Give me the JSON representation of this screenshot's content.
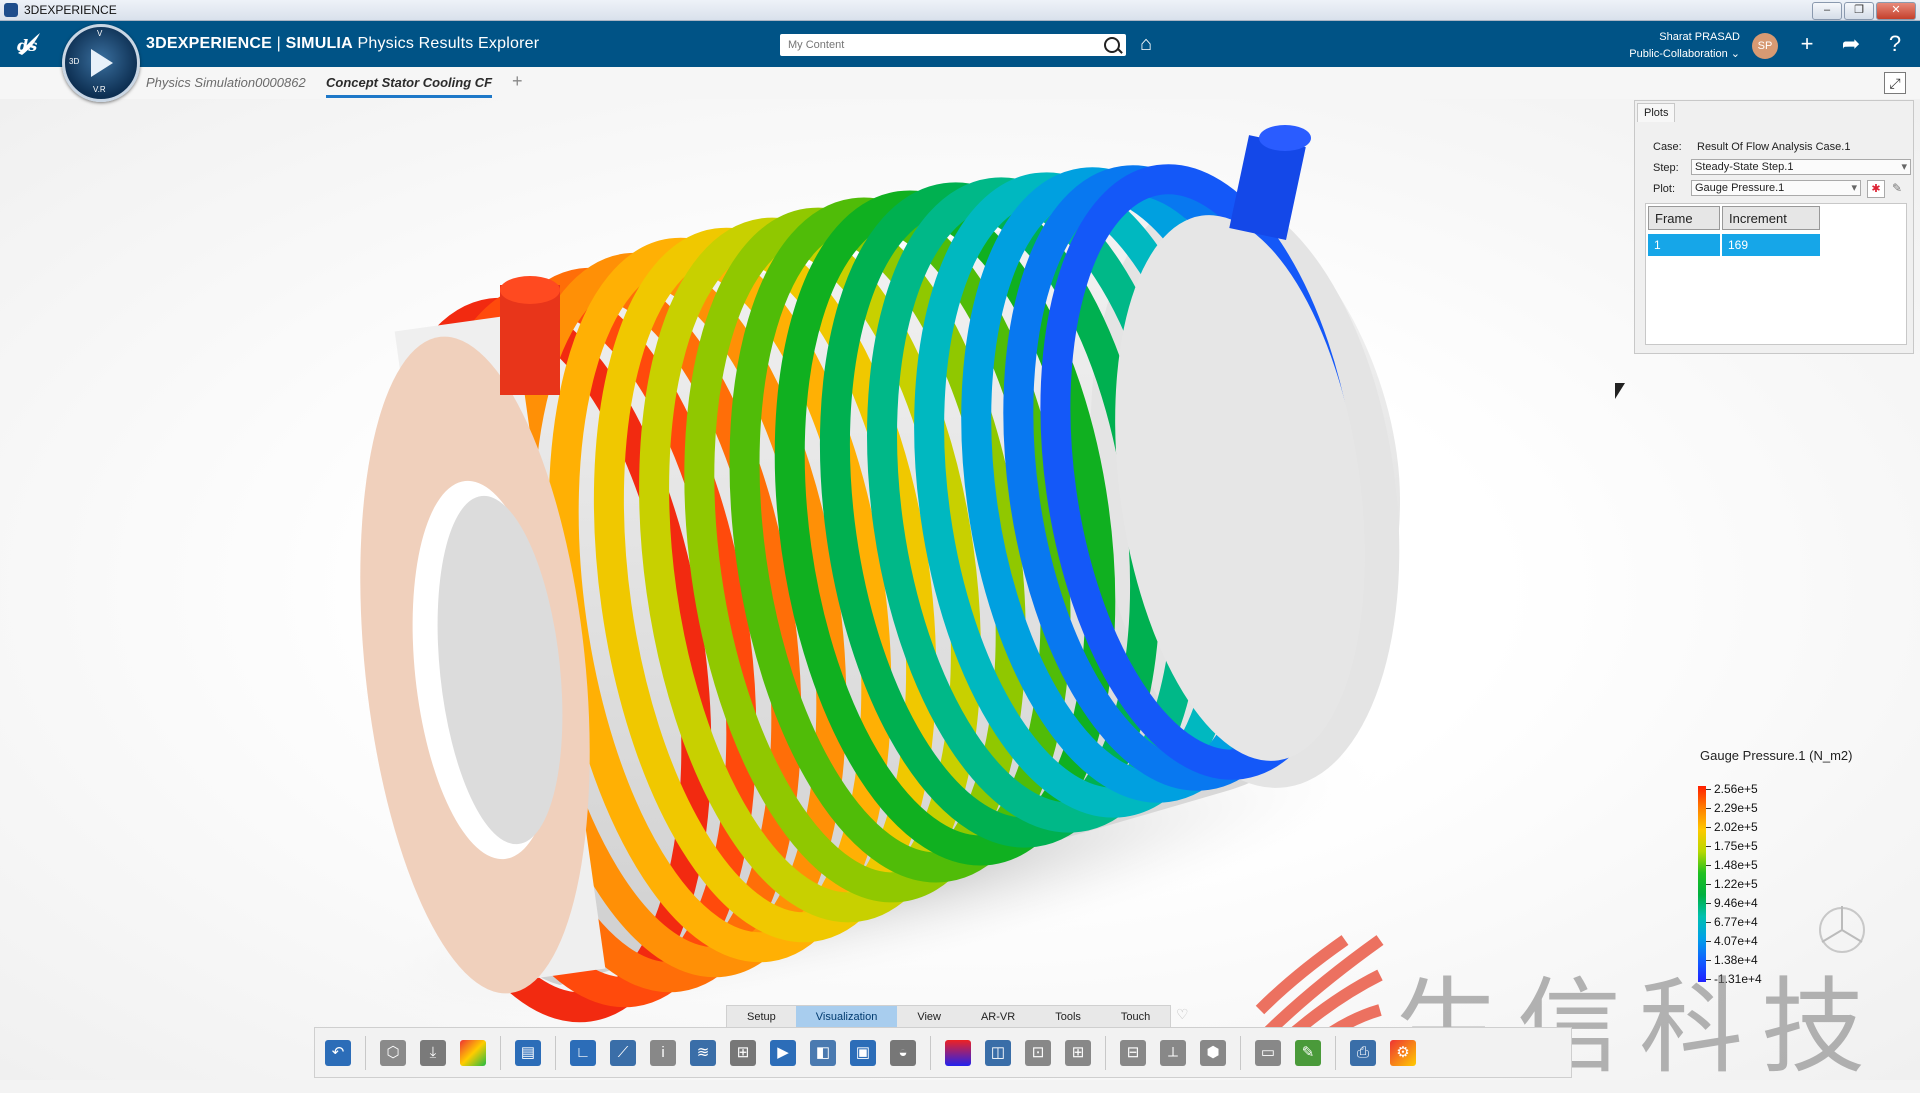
{
  "window": {
    "title": "3DEXPERIENCE",
    "controls": [
      "–",
      "❐",
      "✕"
    ]
  },
  "app": {
    "brand_bold": "3DEXPERIENCE",
    "brand_sep": " | ",
    "brand_sub": "SIMULIA",
    "app_name": " Physics Results Explorer"
  },
  "compass": {
    "top": "V",
    "left": "3D",
    "bottom": "V.R"
  },
  "search": {
    "placeholder": "My Content"
  },
  "user": {
    "name": "Sharat PRASAD",
    "space": "Public-Collaboration",
    "initials": "SP"
  },
  "tabs": [
    {
      "label": "Physics Simulation0000862",
      "active": false
    },
    {
      "label": "Concept Stator Cooling CF",
      "active": true
    }
  ],
  "plots_panel": {
    "tab_label": "Plots",
    "case_label": "Case:",
    "case_value": "Result Of Flow Analysis Case.1",
    "step_label": "Step:",
    "step_value": "Steady-State Step.1",
    "plot_label": "Plot:",
    "plot_value": "Gauge Pressure.1",
    "table": {
      "headers": [
        "Frame",
        "Increment"
      ],
      "rows": [
        [
          "1",
          "169"
        ]
      ]
    }
  },
  "legend": {
    "title": "Gauge Pressure.1 (N_m2)",
    "values": [
      "2.56e+5",
      "2.29e+5",
      "2.02e+5",
      "1.75e+5",
      "1.48e+5",
      "1.22e+5",
      "9.46e+4",
      "6.77e+4",
      "4.07e+4",
      "1.38e+4",
      "-1.31e+4"
    ]
  },
  "toolbar_tabs": [
    {
      "label": "Setup",
      "active": false
    },
    {
      "label": "Visualization",
      "active": true
    },
    {
      "label": "View",
      "active": false
    },
    {
      "label": "AR-VR",
      "active": false
    },
    {
      "label": "Tools",
      "active": false
    },
    {
      "label": "Touch",
      "active": false
    }
  ],
  "toolbar_icons": [
    "undo-icon",
    "part-icon",
    "import-icon",
    "contour-icon",
    "table-icon",
    "axis-icon",
    "xy-plot-icon",
    "probe-icon",
    "streamline-icon",
    "slice-icon",
    "animate-icon",
    "section-icon",
    "cut-icon",
    "iso-icon",
    "legend-icon",
    "view-cube-icon",
    "layout-icon",
    "grid-icon",
    "split-view-icon",
    "triad-icon",
    "assembly-icon",
    "report-icon",
    "settings-icon",
    "capture-icon",
    "options-icon"
  ],
  "watermark": {
    "text": "生信科技"
  },
  "colors": {
    "topbar": "#005386",
    "accent": "#16a6e8",
    "tab_active": "#a8cdee"
  }
}
